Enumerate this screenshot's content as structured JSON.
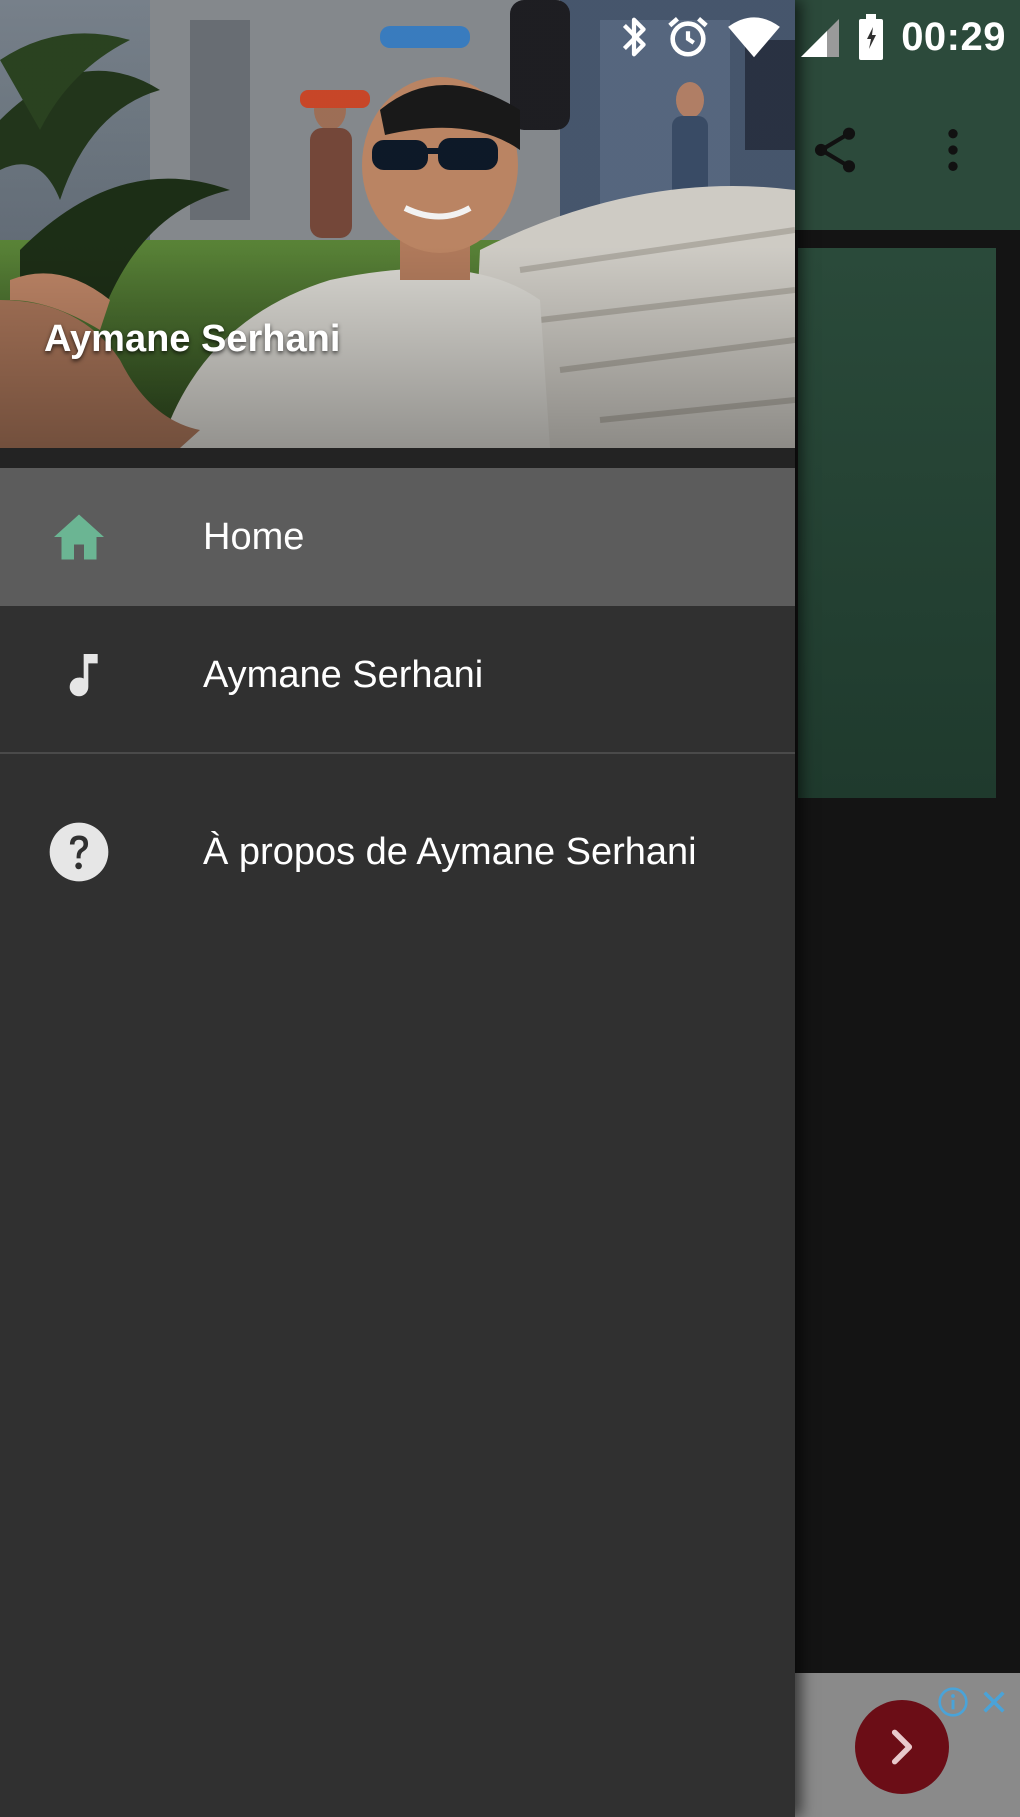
{
  "status_bar": {
    "time": "00:29",
    "icons": [
      "bluetooth-icon",
      "alarm-icon",
      "wifi-icon",
      "signal-icon",
      "battery-icon"
    ]
  },
  "drawer": {
    "header": {
      "title": "Aymane Serhani"
    },
    "items": [
      {
        "label": "Home",
        "icon": "home-icon",
        "active": true,
        "icon_color": "#6bb593"
      },
      {
        "label": "Aymane Serhani",
        "icon": "music-note-icon",
        "active": false,
        "icon_color": "#e6e6e6"
      },
      {
        "label": "À propos de Aymane Serhani",
        "icon": "help-icon",
        "active": false,
        "icon_color": "#e6e6e6"
      }
    ]
  },
  "app": {
    "toolbar_actions": [
      "share-icon",
      "more-vert-icon"
    ],
    "toolbar_color": "#2c4a3b"
  },
  "ad": {
    "button_icon": "chevron-right-icon",
    "accent": "#6b0d16"
  }
}
